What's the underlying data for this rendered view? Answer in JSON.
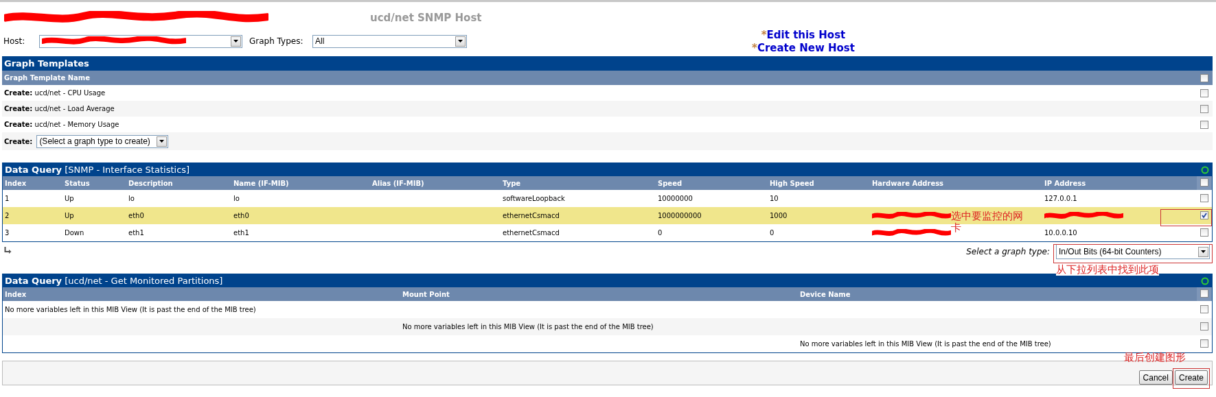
{
  "header": {
    "host_name": {
      "redacted": true
    },
    "title": "ucd/net SNMP Host"
  },
  "filters": [
    {
      "label": "Host:",
      "redacted": true
    },
    {
      "label": "Graph Types:",
      "value": "All",
      "redacted": false
    }
  ],
  "links": [
    {
      "marker": "*",
      "label": "Edit this Host"
    },
    {
      "marker": "*",
      "label": "Create New Host"
    }
  ],
  "graph_templates": {
    "title": "Graph Templates",
    "column": "Graph Template Name",
    "header_checked": false,
    "rows": [
      {
        "prefix": "Create:",
        "name": "ucd/net - CPU Usage",
        "checked": false
      },
      {
        "prefix": "Create:",
        "name": "ucd/net - Load Average",
        "checked": false
      },
      {
        "prefix": "Create:",
        "name": "ucd/net - Memory Usage",
        "checked": false
      }
    ],
    "create_row": {
      "label": "Create:",
      "value": "(Select a graph type to create)"
    }
  },
  "data_queries": [
    {
      "title": "Data Query",
      "subtitle": "[SNMP - Interface Statistics]",
      "header_checked": false,
      "columns": [
        "Index",
        "Status",
        "Description",
        "Name (IF-MIB)",
        "Alias (IF-MIB)",
        "Type",
        "Speed",
        "High Speed",
        "Hardware Address",
        "IP Address"
      ],
      "rows": [
        {
          "selected": false,
          "checked": false,
          "cells": [
            {
              "kind": "text",
              "text": "1"
            },
            {
              "kind": "text",
              "text": "Up"
            },
            {
              "kind": "text",
              "text": "lo"
            },
            {
              "kind": "text",
              "text": "lo"
            },
            {
              "kind": "empty"
            },
            {
              "kind": "text",
              "text": "softwareLoopback"
            },
            {
              "kind": "text",
              "text": "10000000"
            },
            {
              "kind": "text",
              "text": "10"
            },
            {
              "kind": "empty"
            },
            {
              "kind": "text",
              "text": "127.0.0.1"
            }
          ]
        },
        {
          "selected": true,
          "checked": true,
          "cells": [
            {
              "kind": "text",
              "text": "2"
            },
            {
              "kind": "text",
              "text": "Up"
            },
            {
              "kind": "text",
              "text": "eth0"
            },
            {
              "kind": "text",
              "text": "eth0"
            },
            {
              "kind": "empty"
            },
            {
              "kind": "text",
              "text": "ethernetCsmacd"
            },
            {
              "kind": "text",
              "text": "1000000000"
            },
            {
              "kind": "text",
              "text": "1000"
            },
            {
              "kind": "redacted"
            },
            {
              "kind": "redacted"
            }
          ]
        },
        {
          "selected": false,
          "checked": false,
          "cells": [
            {
              "kind": "text",
              "text": "3"
            },
            {
              "kind": "text",
              "text": "Down"
            },
            {
              "kind": "text",
              "text": "eth1"
            },
            {
              "kind": "text",
              "text": "eth1"
            },
            {
              "kind": "empty"
            },
            {
              "kind": "text",
              "text": "ethernetCsmacd"
            },
            {
              "kind": "text",
              "text": "0"
            },
            {
              "kind": "text",
              "text": "0"
            },
            {
              "kind": "redacted"
            },
            {
              "kind": "text",
              "text": "10.0.0.10"
            }
          ]
        }
      ],
      "graph_type": {
        "label": "Select a graph type:",
        "value": "In/Out Bits (64-bit Counters)"
      }
    },
    {
      "title": "Data Query",
      "subtitle": "[ucd/net - Get Monitored Partitions]",
      "header_checked": false,
      "columns": [
        "Index",
        "Mount Point",
        "Device Name"
      ],
      "rows": [
        {
          "selected": false,
          "checked": false,
          "cells": [
            {
              "kind": "text",
              "text": "No more variables left in this MIB View (It is past the end of the MIB tree)"
            },
            {
              "kind": "empty"
            },
            {
              "kind": "empty"
            }
          ]
        },
        {
          "selected": false,
          "checked": false,
          "cells": [
            {
              "kind": "empty"
            },
            {
              "kind": "text",
              "text": "No more variables left in this MIB View (It is past the end of the MIB tree)"
            },
            {
              "kind": "empty"
            }
          ]
        },
        {
          "selected": false,
          "checked": false,
          "cells": [
            {
              "kind": "empty"
            },
            {
              "kind": "empty"
            },
            {
              "kind": "text",
              "text": "No more variables left in this MIB View (It is past the end of the MIB tree)"
            }
          ]
        }
      ]
    }
  ],
  "buttons": [
    {
      "label": "Cancel"
    },
    {
      "label": "Create"
    }
  ],
  "annotations": [
    {
      "kind": "row-note",
      "text": "选中要监控的网卡"
    },
    {
      "kind": "select-note",
      "text": "从下拉列表中找到此项"
    },
    {
      "kind": "button-note",
      "text": "最后创建图形"
    }
  ]
}
